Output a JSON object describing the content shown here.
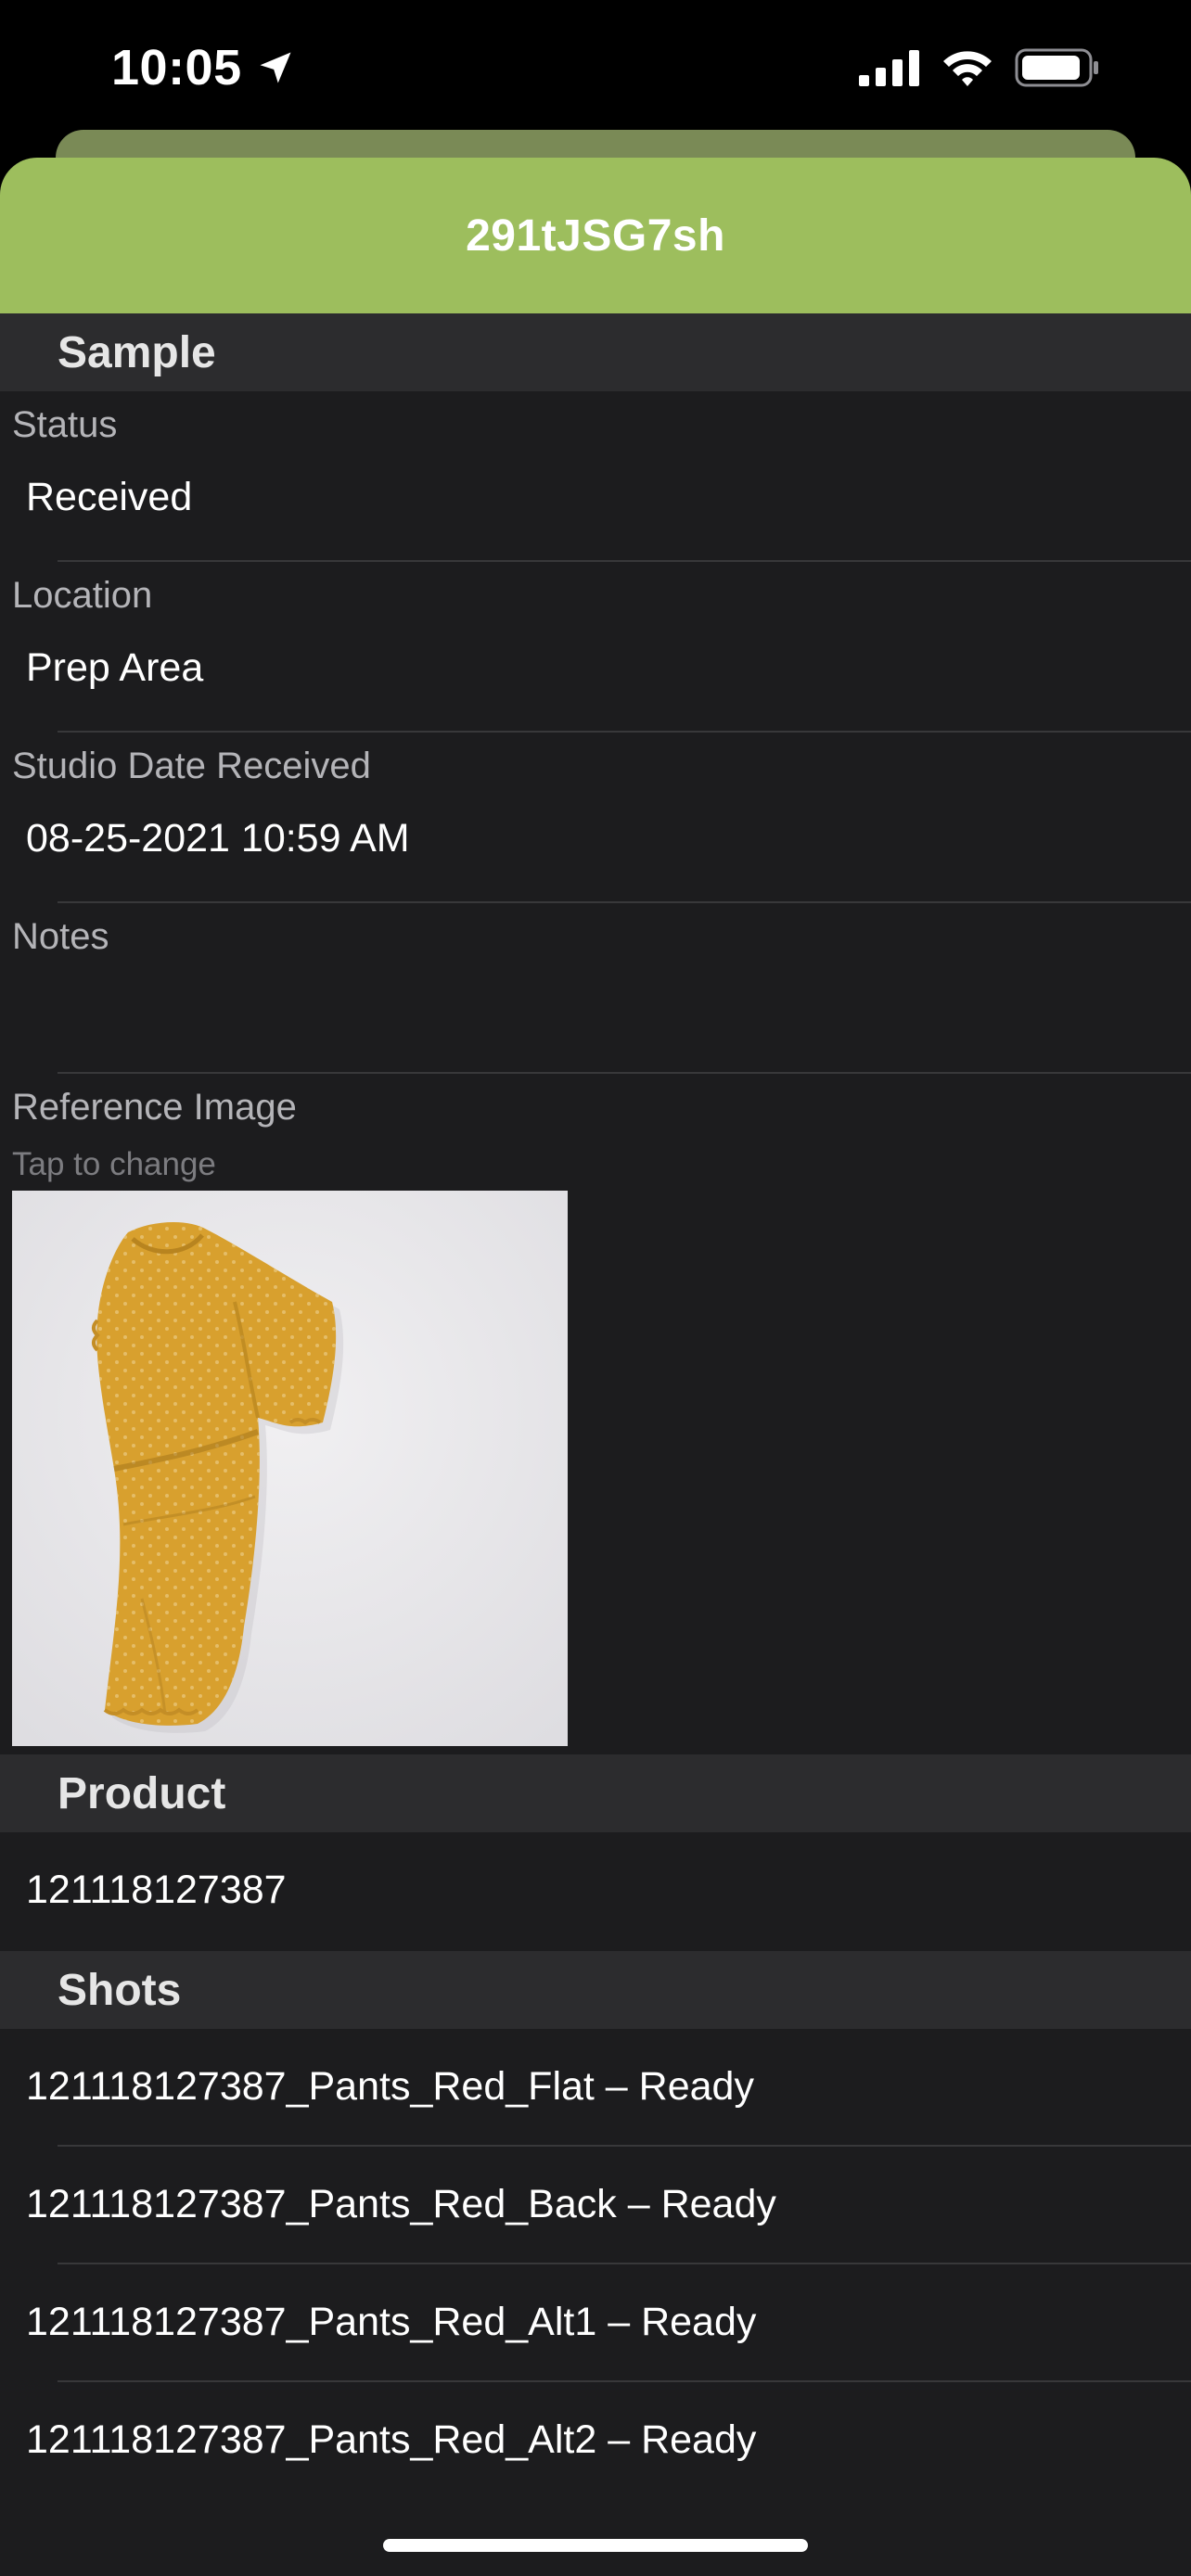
{
  "status_bar": {
    "time": "10:05",
    "icons": [
      "location-arrow-icon",
      "cellular-signal-icon",
      "wifi-icon",
      "battery-icon"
    ]
  },
  "header": {
    "title": "291tJSG7sh",
    "color": "#9dbe5d"
  },
  "sample": {
    "section_title": "Sample",
    "fields": [
      {
        "label": "Status",
        "value": "Received"
      },
      {
        "label": "Location",
        "value": "Prep Area"
      },
      {
        "label": "Studio Date Received",
        "value": "08-25-2021 10:59 AM"
      },
      {
        "label": "Notes",
        "value": ""
      }
    ],
    "reference_image": {
      "label": "Reference Image",
      "hint": "Tap to change",
      "subject": "mustard-yellow-dress"
    }
  },
  "product": {
    "section_title": "Product",
    "value": "121118127387"
  },
  "shots": {
    "section_title": "Shots",
    "items": [
      "121118127387_Pants_Red_Flat – Ready",
      "121118127387_Pants_Red_Back – Ready",
      "121118127387_Pants_Red_Alt1 – Ready",
      "121118127387_Pants_Red_Alt2 – Ready"
    ]
  }
}
